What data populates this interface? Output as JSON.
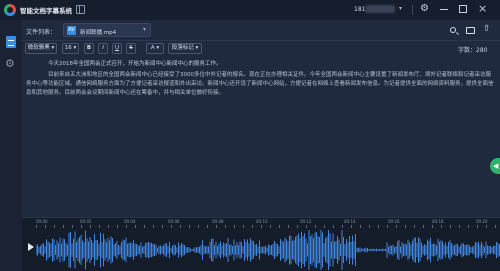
{
  "app": {
    "title": "智能文档字幕系统",
    "user_id": "181"
  },
  "main": {
    "file_label": "文件列表：",
    "file_badge": "AV",
    "file_name": "新闻联播.mp4",
    "toolbar": {
      "font_family": "微软雅黑",
      "font_size": "16",
      "bold": "B",
      "italic": "I",
      "underline": "U",
      "strike": "S",
      "color": "A",
      "mark": "段落标记"
    },
    "word_count": "字数：280",
    "paragraph1": "今天2018年全国两会正式召开，开始为新闻中心新闻中心的服务工作。",
    "paragraph2": "目前来自五大洲和地区的全国两会新闻中心已经接受了3000多位中外记者的报名。现在正在办理相关证件。今年全国两会新闻中心主要设置了新闻发布厅、境外记者联络和记者采访服务中心等功能区域。通信网络服务方面为了方便记者采访报道和外出采访。新闻中心还开设了新闻中心网站，方便记者在网络上查看新闻发布信息。为记者提供全面的网络资料服务，提供全面信息和其他服务。目前两会会议期间新闻中心还在筹备中，并与相关单位做好衔接。"
  },
  "timeline": {
    "ruler_labels": [
      "00:00",
      "00:02",
      "00:04",
      "00:06",
      "00:08",
      "00:10",
      "00:12",
      "00:14",
      "00:16",
      "00:18",
      "00:20"
    ]
  },
  "colors": {
    "accent": "#3a8dde",
    "waveform": "#3f86e0",
    "background": "#1d2639",
    "help_bubble": "#2fb36b"
  },
  "icons": [
    "app-logo-icon",
    "collapse-sidebar-icon",
    "chevron-down-icon",
    "gear-icon",
    "minimize-icon",
    "maximize-icon",
    "close-icon",
    "document-icon",
    "settings-icon",
    "search-icon",
    "folder-icon",
    "share-icon",
    "play-icon"
  ]
}
